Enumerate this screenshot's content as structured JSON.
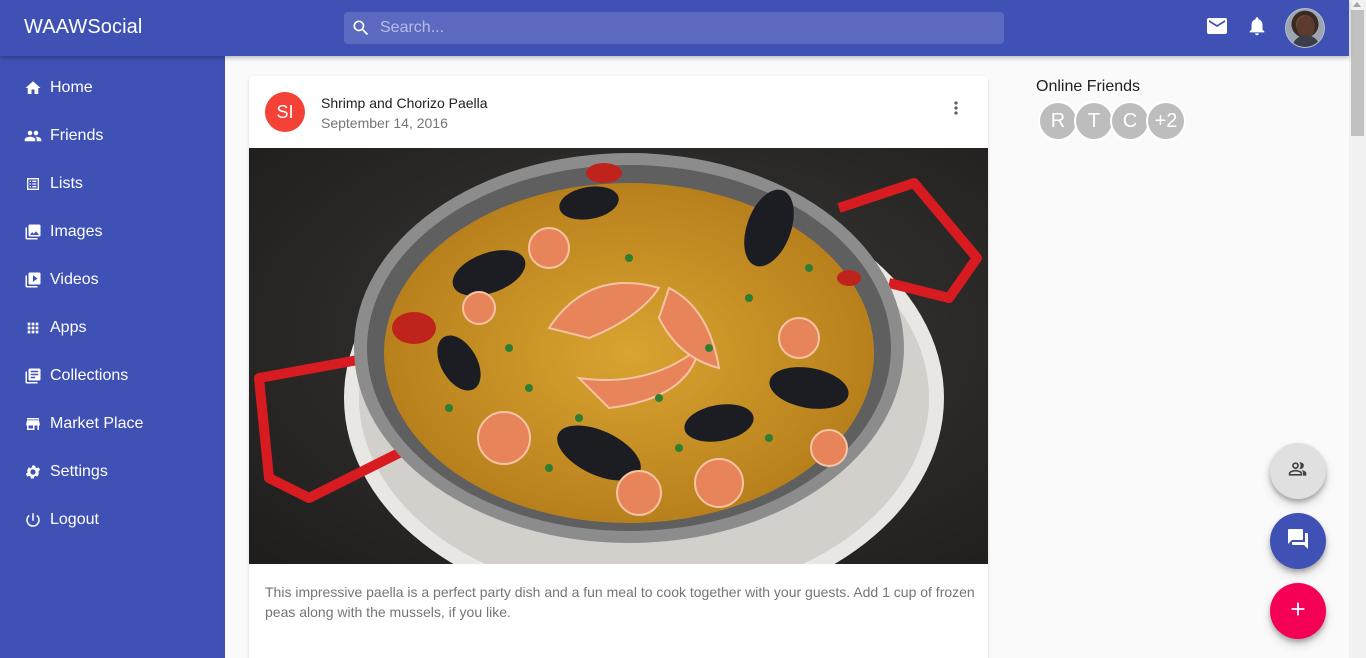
{
  "app": {
    "brand": "WAAWSocial"
  },
  "search": {
    "placeholder": "Search..."
  },
  "header": {
    "icons": [
      "mail-icon",
      "bell-icon",
      "avatar"
    ]
  },
  "sidebar": {
    "items": [
      {
        "label": "Home",
        "icon": "home-icon"
      },
      {
        "label": "Friends",
        "icon": "people-icon"
      },
      {
        "label": "Lists",
        "icon": "list-icon"
      },
      {
        "label": "Images",
        "icon": "images-icon"
      },
      {
        "label": "Videos",
        "icon": "video-icon"
      },
      {
        "label": "Apps",
        "icon": "apps-icon"
      },
      {
        "label": "Collections",
        "icon": "collections-icon"
      },
      {
        "label": "Market Place",
        "icon": "store-icon"
      },
      {
        "label": "Settings",
        "icon": "gear-icon"
      },
      {
        "label": "Logout",
        "icon": "power-icon"
      }
    ]
  },
  "post": {
    "avatar_initials": "SI",
    "title": "Shrimp and Chorizo Paella",
    "date": "September 14, 2016",
    "body": "This impressive paella is a perfect party dish and a fun meal to cook together with your guests. Add 1 cup of frozen peas along with the mussels, if you like."
  },
  "online_friends": {
    "title": "Online Friends",
    "avatars": [
      "R",
      "T",
      "C",
      "+2"
    ]
  },
  "fabs": [
    "people-icon",
    "chat-icon",
    "add-icon"
  ],
  "colors": {
    "primary": "#3f51b5",
    "accent": "#f50057",
    "post_avatar": "#f44336"
  }
}
